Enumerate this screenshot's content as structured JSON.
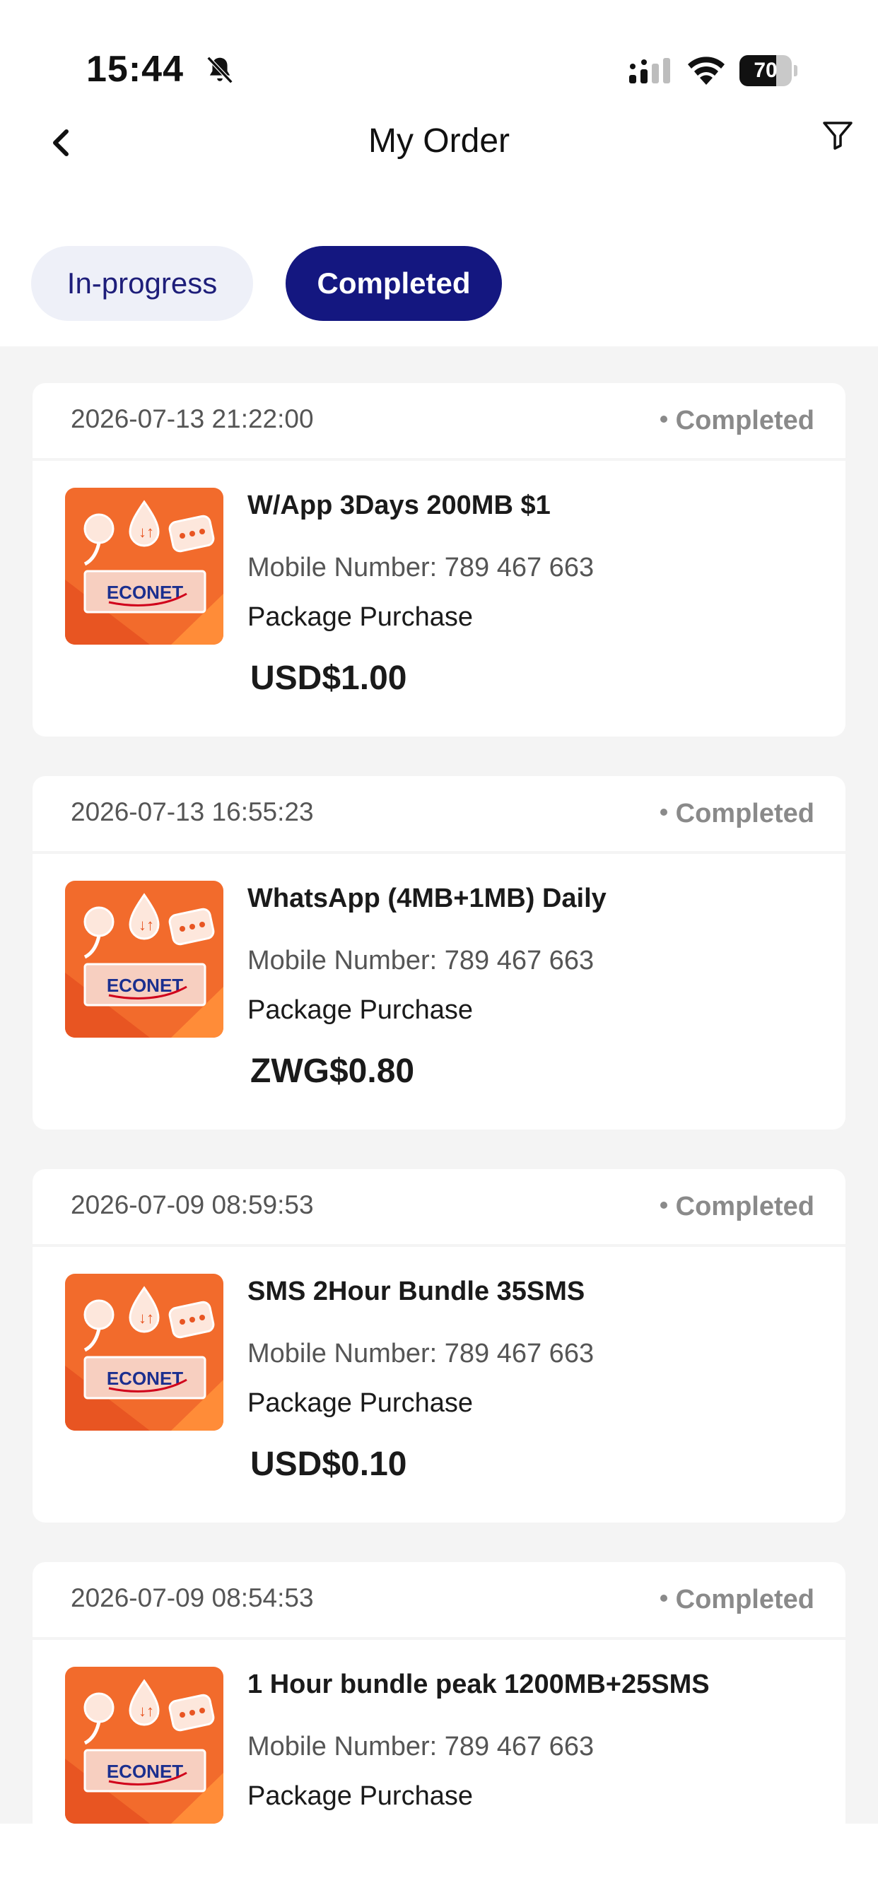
{
  "status_bar": {
    "time": "15:44",
    "battery": "70",
    "battery_level": 0.7,
    "icons": [
      "bell-muted-icon",
      "signal-icon",
      "wifi-icon",
      "battery-icon"
    ]
  },
  "header": {
    "title": "My Order",
    "back_icon": "chevron-left-icon",
    "filter_icon": "filter-icon"
  },
  "tabs": [
    {
      "label": "In-progress",
      "active": false
    },
    {
      "label": "Completed",
      "active": true
    }
  ],
  "orders": [
    {
      "datetime": "2026-07-13 21:22:00",
      "status": "Completed",
      "name": "W/App 3Days 200MB $1",
      "mobile": "Mobile Number: 789 467 663",
      "type": "Package Purchase",
      "price": "USD$1.00",
      "brand": "ECONET"
    },
    {
      "datetime": "2026-07-13 16:55:23",
      "status": "Completed",
      "name": "WhatsApp (4MB+1MB) Daily",
      "mobile": "Mobile Number: 789 467 663",
      "type": "Package Purchase",
      "price": "ZWG$0.80",
      "brand": "ECONET"
    },
    {
      "datetime": "2026-07-09 08:59:53",
      "status": "Completed",
      "name": "SMS 2Hour Bundle 35SMS",
      "mobile": "Mobile Number: 789 467 663",
      "type": "Package Purchase",
      "price": "USD$0.10",
      "brand": "ECONET"
    },
    {
      "datetime": "2026-07-09 08:54:53",
      "status": "Completed",
      "name": "1 Hour bundle peak 1200MB+25SMS",
      "mobile": "Mobile Number: 789 467 663",
      "type": "Package Purchase",
      "price": "",
      "brand": "ECONET"
    }
  ],
  "colors": {
    "accent": "#141780",
    "tab_inactive_bg": "#eef0f8",
    "list_bg": "#f4f4f4",
    "thumb_orange": "#f26b2c",
    "econet_blue": "#1b2f8f"
  }
}
